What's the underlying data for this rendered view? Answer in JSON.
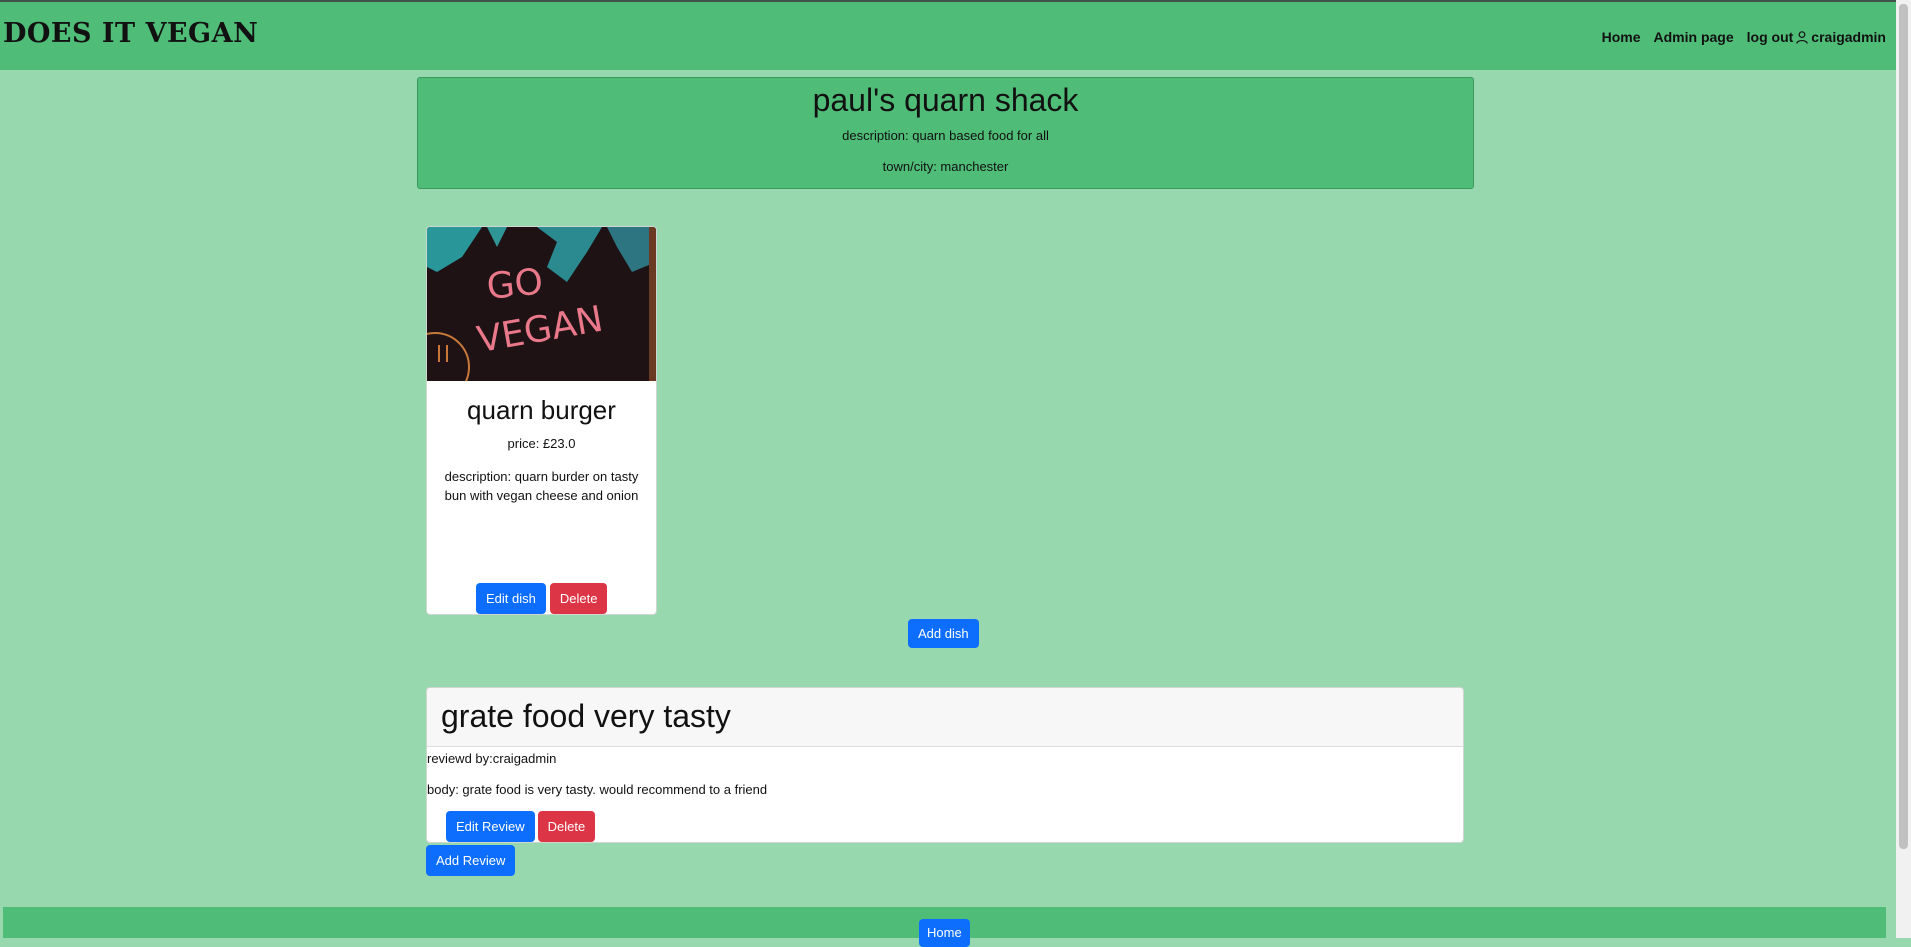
{
  "app": {
    "brand": "DOES IT VEGAN"
  },
  "nav": {
    "home": "Home",
    "admin": "Admin page",
    "logout": "log out",
    "username": "craigadmin"
  },
  "restaurant": {
    "name": "paul's quarn shack",
    "description": "description: quarn based food for all",
    "town": "town/city: manchester"
  },
  "dishes": [
    {
      "image_text": [
        "GO",
        "VEGAN"
      ],
      "name": "quarn burger",
      "price": "price: £23.0",
      "description": "description: quarn burder on tasty bun with vegan cheese and onion",
      "edit_label": "Edit dish",
      "delete_label": "Delete"
    }
  ],
  "add_dish_label": "Add dish",
  "reviews": [
    {
      "title": "grate food very tasty",
      "reviewer": "reviewd by:craigadmin",
      "body": "body: grate food is very tasty. would recommend to a friend",
      "edit_label": "Edit Review",
      "delete_label": "Delete"
    }
  ],
  "add_review_label": "Add Review",
  "footer": {
    "home_label": "Home"
  },
  "colors": {
    "navbar": "#4fbc77",
    "background": "#98d8ae",
    "primary": "#0d6efd",
    "danger": "#dc3545"
  }
}
